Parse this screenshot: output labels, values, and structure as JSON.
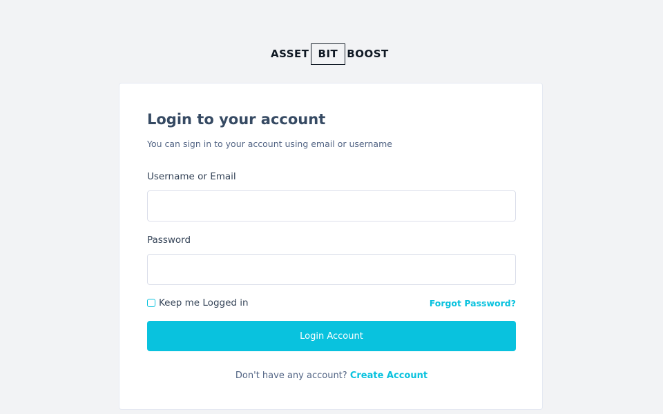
{
  "brand": {
    "logo_part1": "ASSET",
    "logo_part2": "BIT",
    "logo_part3": "BOOST"
  },
  "login": {
    "title": "Login to your account",
    "subtitle": "You can sign in to your account using email or username",
    "username_label": "Username or Email",
    "username_value": "",
    "username_placeholder": "",
    "password_label": "Password",
    "password_value": "",
    "password_placeholder": "",
    "remember_label": "Keep me Logged in",
    "remember_checked": false,
    "forgot_label": "Forgot Password?",
    "submit_label": "Login Account",
    "signup_prompt": "Don't have any account?",
    "signup_link": "Create Account"
  },
  "colors": {
    "accent": "#09c2de",
    "background": "#f2f3f5",
    "card": "#ffffff",
    "heading": "#364a63"
  }
}
